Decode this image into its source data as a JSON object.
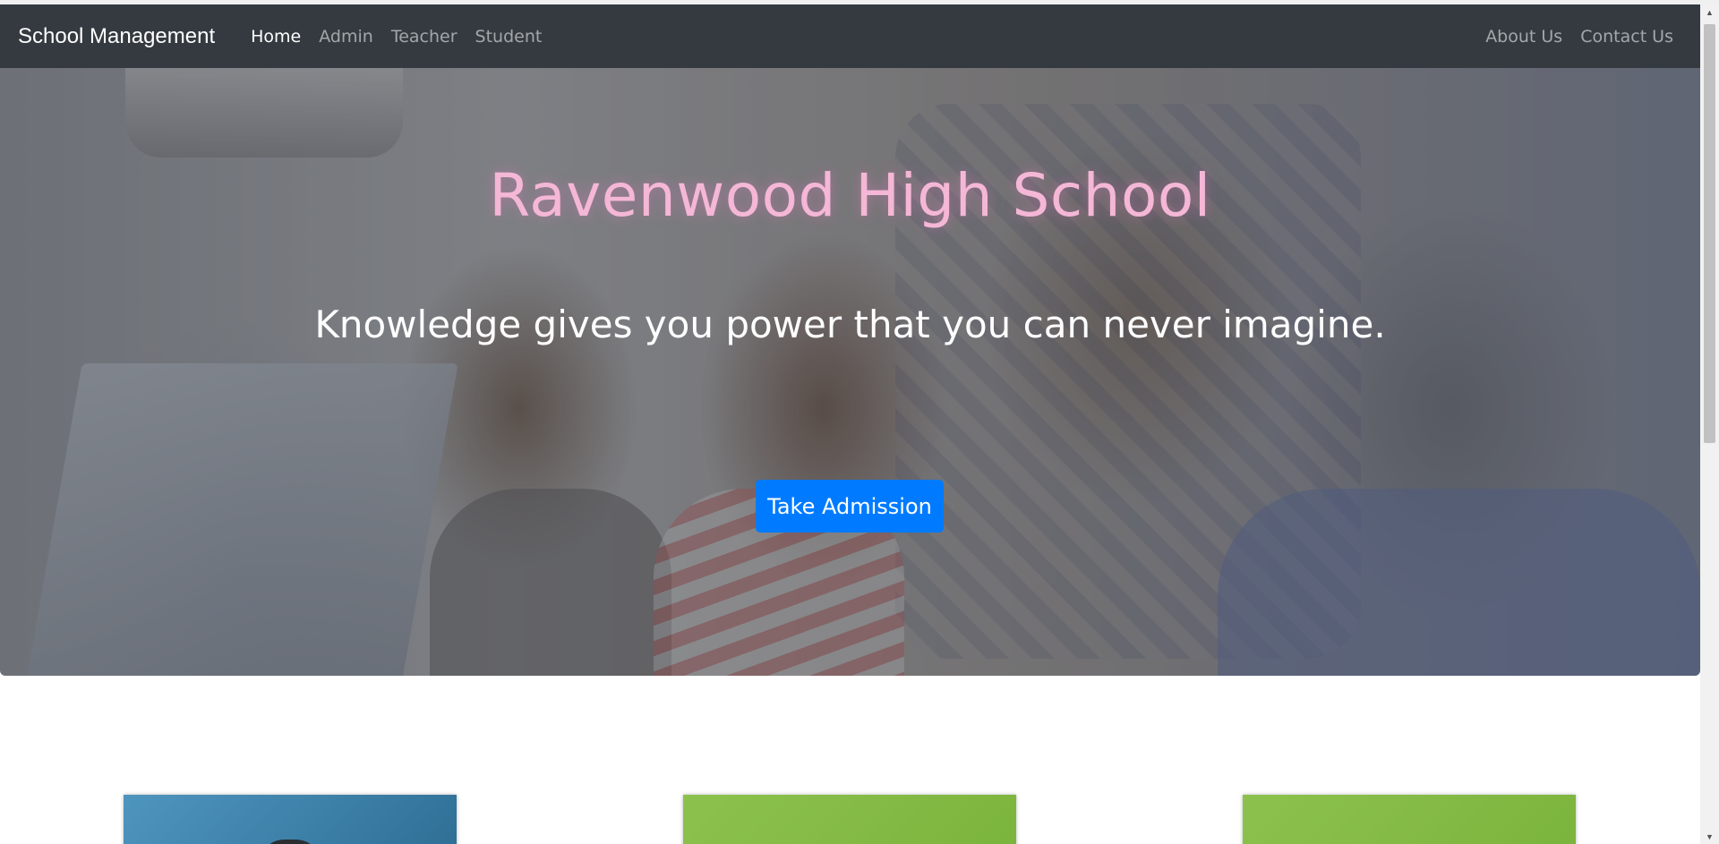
{
  "navbar": {
    "brand": "School Management",
    "left_links": [
      "Home",
      "Admin",
      "Teacher",
      "Student"
    ],
    "active_link": "Home",
    "right_links": [
      "About Us",
      "Contact Us"
    ]
  },
  "hero": {
    "title": "Ravenwood High School",
    "subtitle": "Knowledge gives you power that you can never imagine.",
    "cta_label": "Take Admission"
  },
  "cards": [
    {
      "color": "#3d84ad"
    },
    {
      "color": "#84bb45"
    },
    {
      "color": "#84bb45"
    }
  ],
  "colors": {
    "navbar_bg": "#343a40",
    "title_color": "#f5b7d6",
    "button_bg": "#007bff"
  },
  "icons": {
    "scroll_up": "triangle-up-icon",
    "scroll_down": "triangle-down-icon"
  }
}
